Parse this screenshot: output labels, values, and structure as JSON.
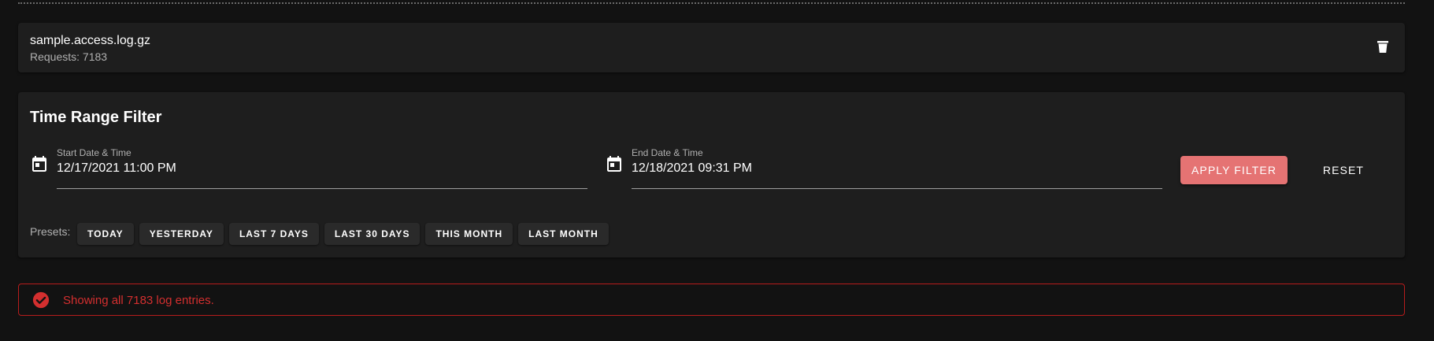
{
  "file": {
    "name": "sample.access.log.gz",
    "requests": "Requests: 7183",
    "delete_icon": "trash-icon"
  },
  "filter": {
    "title": "Time Range Filter",
    "start": {
      "label": "Start Date & Time",
      "value": "12/17/2021 11:00 PM",
      "icon": "calendar-icon"
    },
    "end": {
      "label": "End Date & Time",
      "value": "12/18/2021 09:31 PM",
      "icon": "calendar-icon"
    },
    "apply_label": "APPLY FILTER",
    "reset_label": "RESET",
    "presets_label": "Presets:",
    "presets": [
      "TODAY",
      "YESTERDAY",
      "LAST 7 DAYS",
      "LAST 30 DAYS",
      "THIS MONTH",
      "LAST MONTH"
    ]
  },
  "alert": {
    "icon": "check-circle-icon",
    "text": "Showing all 7183 log entries."
  },
  "colors": {
    "background": "#121212",
    "card": "#1e1e1e",
    "accent": "#e57373",
    "alert": "#d32f2f"
  }
}
